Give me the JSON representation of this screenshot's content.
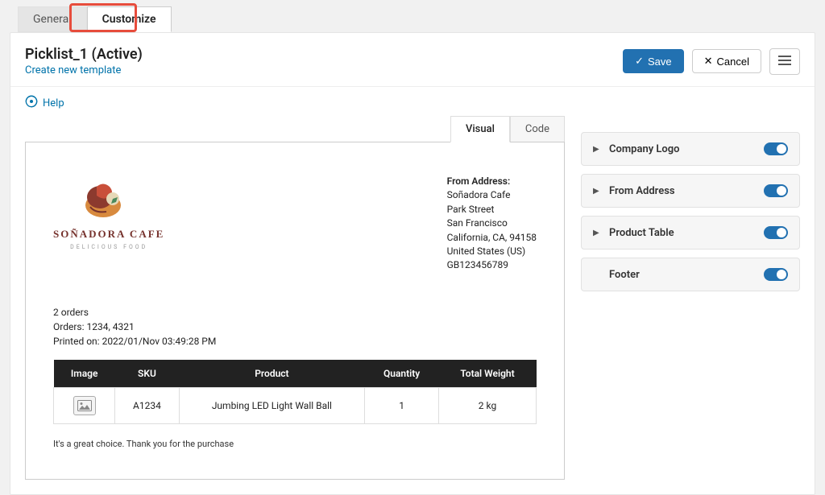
{
  "tabs": {
    "t0": "General",
    "t1": "Customize"
  },
  "header": {
    "title": "Picklist_1 (Active)",
    "create_link": "Create new template",
    "save": "Save",
    "cancel": "Cancel"
  },
  "help": {
    "label": "Help"
  },
  "editor_tabs": {
    "visual": "Visual",
    "code": "Code"
  },
  "doc": {
    "brand": {
      "name": "SOÑADORA CAFE",
      "tag": "DELICIOUS FOOD"
    },
    "from": {
      "label": "From Address:",
      "name": "Soñadora Cafe",
      "street": "Park Street",
      "city": "San Francisco",
      "region": "California, CA, 94158",
      "country": "United States (US)",
      "code": "GB123456789"
    },
    "meta": {
      "orders_count": "2 orders",
      "orders": "Orders: 1234, 4321",
      "printed": "Printed on: 2022/01/Nov 03:49:28 PM"
    },
    "table": {
      "headers": {
        "image": "Image",
        "sku": "SKU",
        "product": "Product",
        "qty": "Quantity",
        "weight": "Total Weight"
      },
      "rows": [
        {
          "sku": "A1234",
          "product": "Jumbing LED Light Wall Ball",
          "qty": "1",
          "weight": "2 kg"
        }
      ]
    },
    "footer": "It's a great choice. Thank you for the purchase"
  },
  "options": {
    "o0": "Company Logo",
    "o1": "From Address",
    "o2": "Product Table",
    "o3": "Footer"
  }
}
